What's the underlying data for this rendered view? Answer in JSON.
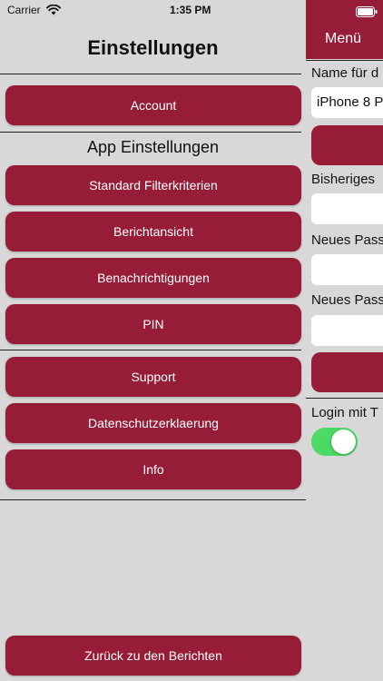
{
  "status_bar": {
    "carrier": "Carrier",
    "time": "1:35 PM"
  },
  "title": "Einstellungen",
  "buttons": {
    "account": "Account",
    "standard_filter": "Standard Filterkriterien",
    "berichtansicht": "Berichtansicht",
    "benachrichtigungen": "Benachrichtigungen",
    "pin": "PIN",
    "support": "Support",
    "datenschutz": "Datenschutzerklaerung",
    "info": "Info",
    "zurueck": "Zurück zu den Berichten"
  },
  "section_title": "App Einstellungen",
  "side_panel": {
    "menu_title": "Menü",
    "device_name_label": "Name für d",
    "device_name_value": "iPhone 8 P",
    "old_password_label": "Bisheriges",
    "new_password_label": "Neues Pass",
    "new_password_repeat_label": "Neues Pass",
    "login_touch_label": "Login mit T",
    "login_touch_enabled": true
  },
  "colors": {
    "accent": "#971c38",
    "background": "#d8d8d8",
    "toggle_on": "#4cd964"
  }
}
